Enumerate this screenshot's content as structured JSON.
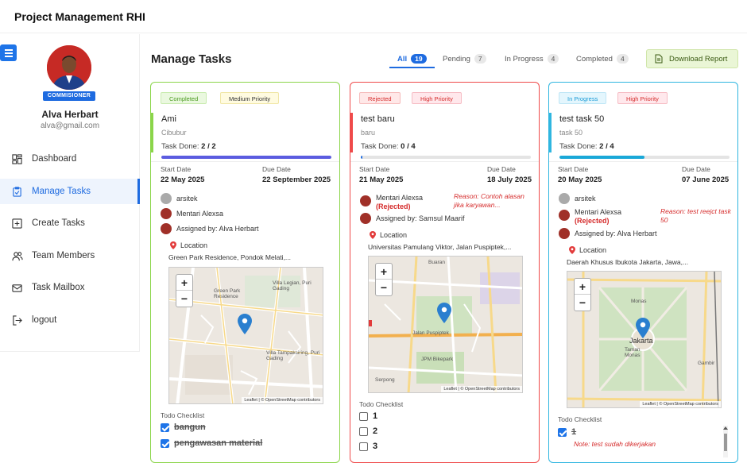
{
  "app": {
    "title": "Project Management RHI"
  },
  "profile": {
    "role": "COMMISIONER",
    "name": "Alva Herbart",
    "email": "alva@gmail.com"
  },
  "nav": [
    {
      "label": "Dashboard",
      "icon": "dashboard-icon"
    },
    {
      "label": "Manage Tasks",
      "icon": "clipboard-check-icon",
      "active": true
    },
    {
      "label": "Create Tasks",
      "icon": "plus-square-icon"
    },
    {
      "label": "Team Members",
      "icon": "users-icon"
    },
    {
      "label": "Task Mailbox",
      "icon": "mail-icon"
    },
    {
      "label": "logout",
      "icon": "logout-icon"
    }
  ],
  "page": {
    "title": "Manage Tasks",
    "download_label": "Download Report"
  },
  "tabs": [
    {
      "label": "All",
      "count": "19",
      "active": true
    },
    {
      "label": "Pending",
      "count": "7"
    },
    {
      "label": "In Progress",
      "count": "4"
    },
    {
      "label": "Completed",
      "count": "4"
    }
  ],
  "labels": {
    "start_date": "Start Date",
    "due_date": "Due Date",
    "location": "Location",
    "todo_checklist": "Todo Checklist",
    "task_done": "Task Done:",
    "map_attr": "Leaflet | © OpenStreetMap contributors",
    "zoom_in": "+",
    "zoom_out": "−"
  },
  "cards": [
    {
      "status": "Completed",
      "priority": "Medium Priority",
      "title": "Ami",
      "subtitle": "Cibubur",
      "done": "2 / 2",
      "progress": 1.0,
      "start": "22 May 2025",
      "due": "22 September 2025",
      "assignees": [
        "arsitek",
        "Mentari Alexsa"
      ],
      "assigned_by": "Assigned by: Alva Herbart",
      "address": "Green Park Residence, Pondok Melati,...",
      "map_labels": [
        "Green Park Residence",
        "Villa Legian, Puri Gading",
        "Villa Tampaksiring, Puri Gading"
      ],
      "todos": [
        {
          "text": "bangun",
          "done": true
        },
        {
          "text": "pengawasan material",
          "done": true
        }
      ],
      "accent": "#8bd54a",
      "bar": "#5b5ce0"
    },
    {
      "status": "Rejected",
      "priority": "High Priority",
      "title": "test baru",
      "subtitle": "baru",
      "done": "0 / 4",
      "progress": 0.0,
      "start": "21 May 2025",
      "due": "18 July 2025",
      "rejected_person": "Mentari Alexsa",
      "rejected_tag": "(Rejected)",
      "reason": "Reason: Contoh alasan jika karyawan...",
      "assigned_by": "Assigned by: Samsul Maarif",
      "address": "Universitas Pamulang Viktor, Jalan Puspiptek,...",
      "map_labels": [
        "Buaran",
        "Jalan Puspiptek",
        "JPM Bikepark",
        "Serpong"
      ],
      "todos": [
        {
          "text": "1",
          "done": false
        },
        {
          "text": "2",
          "done": false
        },
        {
          "text": "3",
          "done": false
        }
      ],
      "accent": "#ef4a4a",
      "bar": "#cccccc"
    },
    {
      "status": "In Progress",
      "priority": "High Priority",
      "title": "test task 50",
      "subtitle": "task 50",
      "done": "2 / 4",
      "progress": 0.5,
      "start": "20 May 2025",
      "due": "07 June 2025",
      "assignees": [
        "arsitek"
      ],
      "rejected_person": "Mentari Alexsa",
      "rejected_tag": "(Rejected)",
      "reason": "Reason: test reejct task 50",
      "assigned_by": "Assigned by: Alva Herbart",
      "address": "Daerah Khusus Ibukota Jakarta, Jawa,...",
      "map_labels": [
        "Monas",
        "Jakarta",
        "Taman Monas",
        "Gambir"
      ],
      "todos": [
        {
          "text": "1",
          "done": true
        }
      ],
      "note": "Note: test sudah dikerjakan",
      "accent": "#2fb6e0",
      "bar": "#1aa8d8"
    }
  ]
}
